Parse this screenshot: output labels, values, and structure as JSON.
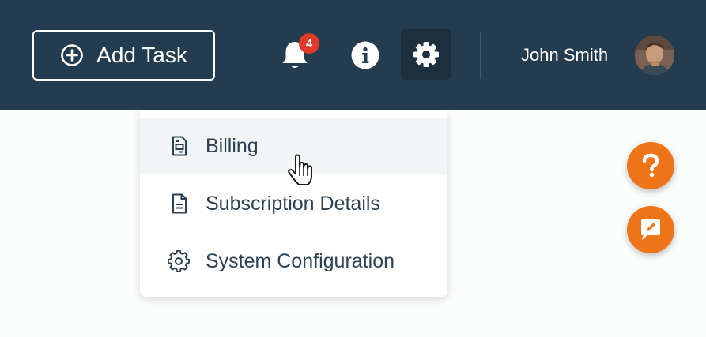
{
  "header": {
    "add_task_label": "Add Task",
    "notification_count": "4",
    "user_name": "John Smith"
  },
  "settings_menu": {
    "items": [
      {
        "label": "Billing",
        "icon": "billing-icon",
        "hovered": true
      },
      {
        "label": "Subscription Details",
        "icon": "document-icon",
        "hovered": false
      },
      {
        "label": "System Configuration",
        "icon": "gear-icon",
        "hovered": false
      }
    ]
  },
  "floating_actions": [
    {
      "icon": "question-mark-icon"
    },
    {
      "icon": "feedback-icon"
    }
  ],
  "colors": {
    "header_bg": "#243c4f",
    "accent": "#ee7417",
    "badge": "#e03a2a",
    "menu_text": "#2c4252"
  }
}
